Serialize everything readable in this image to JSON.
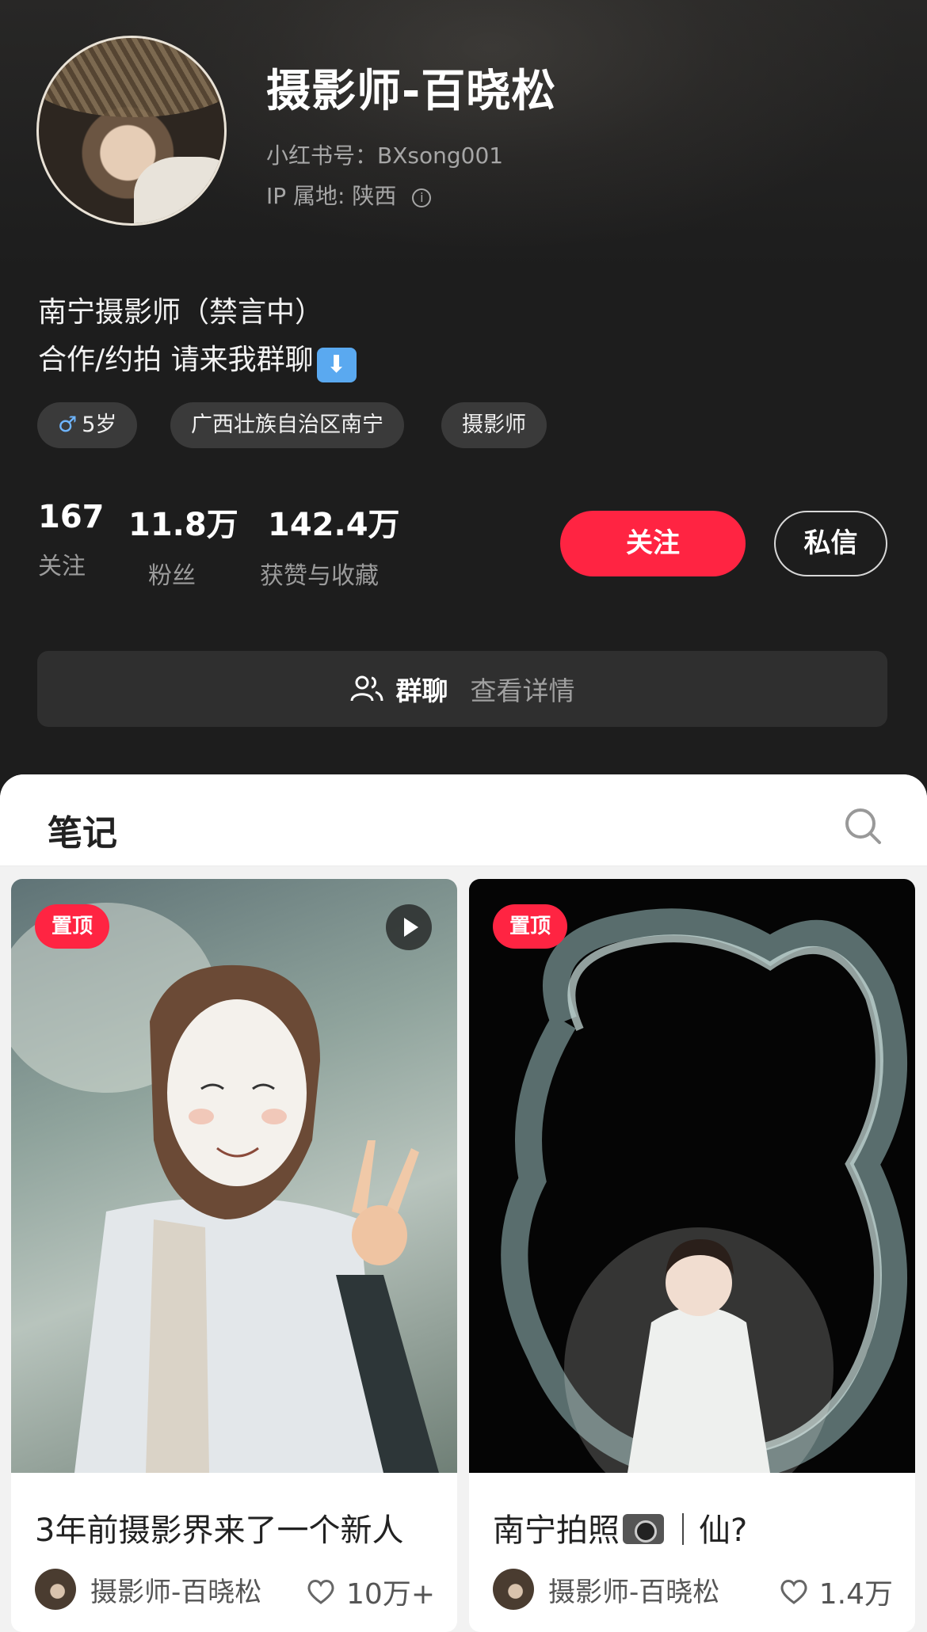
{
  "profile": {
    "name": "摄影师-百晓松",
    "red_id": "小红书号：BXsong001",
    "ip_location": "IP 属地: 陕西",
    "bio_line1": "南宁摄影师（禁言中）",
    "bio_line2": "合作/约拍 请来我群聊",
    "bio_emoji": "⬇"
  },
  "tags": {
    "gender_icon": "♂",
    "age": "5岁",
    "region": "广西壮族自治区南宁",
    "profession": "摄影师"
  },
  "stats": {
    "following_count": "167",
    "following_label": "关注",
    "followers_count": "11.8万",
    "followers_label": "粉丝",
    "likes_count": "142.4万",
    "likes_label": "获赞与收藏"
  },
  "actions": {
    "follow": "关注",
    "message": "私信"
  },
  "group_chat": {
    "label": "群聊",
    "detail": "查看详情"
  },
  "notes_tab": {
    "label": "笔记"
  },
  "cards": [
    {
      "pinned": "置顶",
      "is_video": true,
      "title": "3年前摄影界来了一个新人",
      "author": "摄影师-百晓松",
      "likes": "10万+"
    },
    {
      "pinned": "置顶",
      "is_video": false,
      "title_before": "南宁拍照",
      "title_after": "｜仙?",
      "author": "摄影师-百晓松",
      "likes": "1.4万"
    }
  ],
  "colors": {
    "accent": "#ff2442",
    "background": "#1e1e1e"
  },
  "icons": [
    "info-icon",
    "gender-male-icon",
    "down-arrow-emoji-icon",
    "group-people-icon",
    "search-icon",
    "play-icon",
    "heart-icon",
    "camera-emoji-icon"
  ]
}
